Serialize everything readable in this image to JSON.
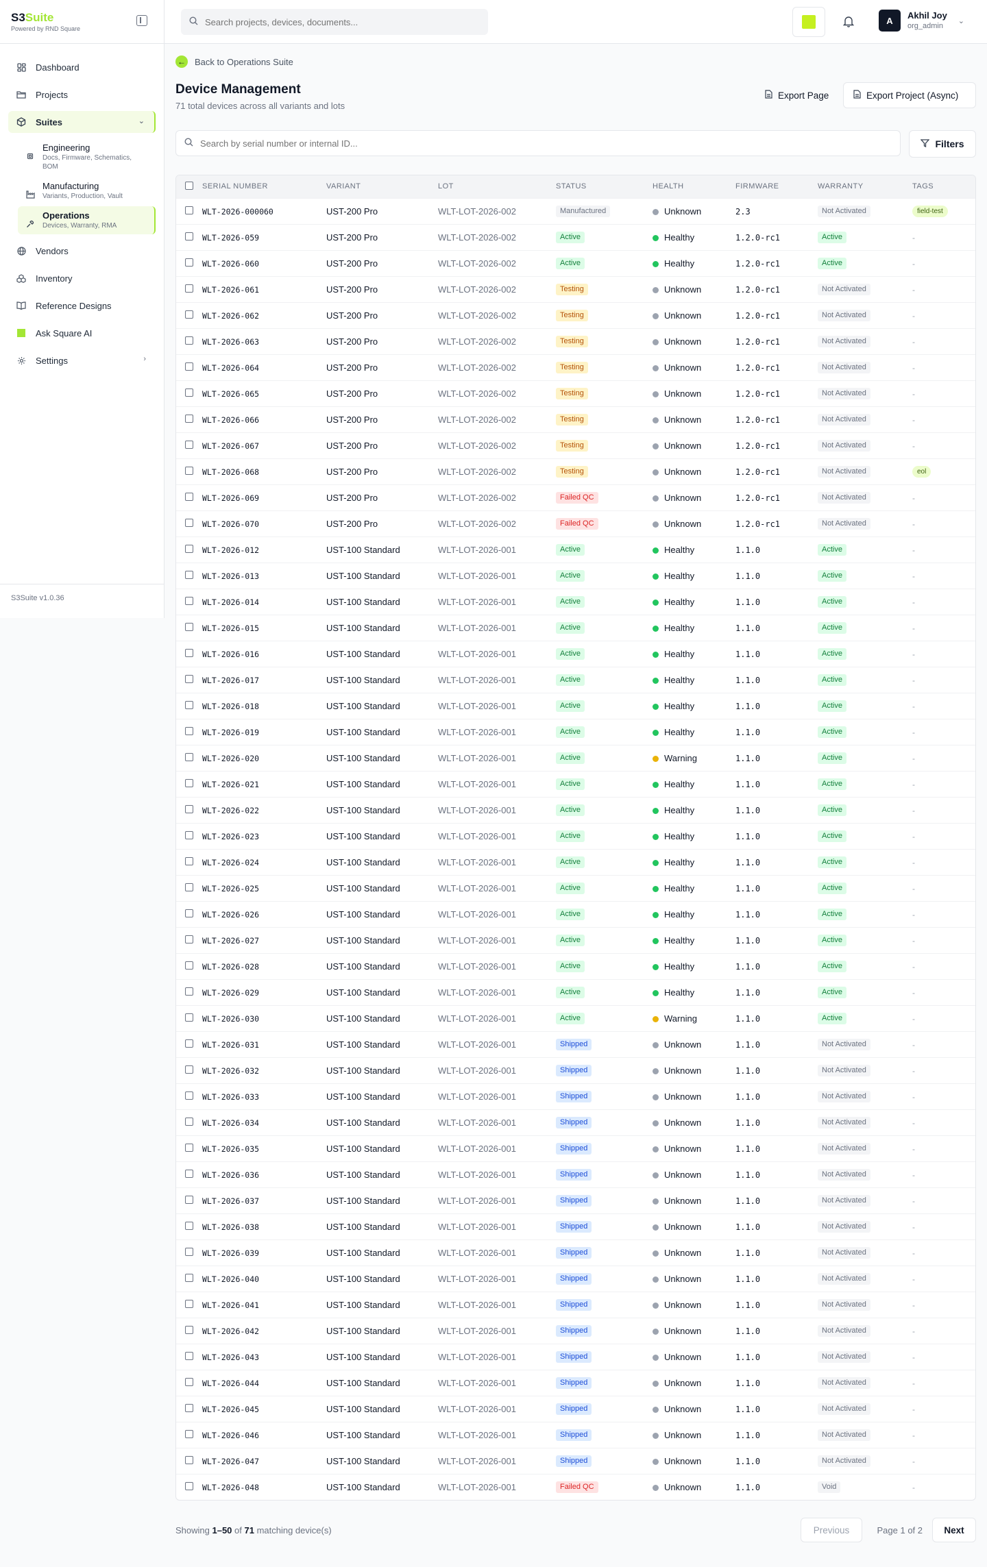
{
  "brand": {
    "name_a": "S3",
    "name_b": "Suite",
    "sub": "Powered by RND Square",
    "accent": "#a3e635"
  },
  "sidebar": {
    "items": [
      {
        "label": "Dashboard",
        "icon": "grid-icon"
      },
      {
        "label": "Projects",
        "icon": "folder-icon"
      },
      {
        "label": "Suites",
        "icon": "box-icon"
      }
    ],
    "sub_items": [
      {
        "title": "Engineering",
        "desc": "Docs, Firmware, Schematics, BOM",
        "icon": "chip-icon"
      },
      {
        "title": "Manufacturing",
        "desc": "Variants, Production, Vault",
        "icon": "factory-icon"
      },
      {
        "title": "Operations",
        "desc": "Devices, Warranty, RMA",
        "icon": "wrench-icon"
      }
    ],
    "items_after": [
      {
        "label": "Vendors",
        "icon": "globe-icon"
      },
      {
        "label": "Inventory",
        "icon": "boxes-icon"
      },
      {
        "label": "Reference Designs",
        "icon": "book-icon"
      },
      {
        "label": "Ask Square AI",
        "icon": "ai-square-icon"
      },
      {
        "label": "Settings",
        "icon": "gear-icon"
      }
    ],
    "version": "S3Suite v1.0.36"
  },
  "topbar": {
    "search_placeholder": "Search projects, devices, documents...",
    "user_initial": "A",
    "user_name": "Akhil Joy",
    "user_role": "org_admin"
  },
  "page": {
    "back_label": "Back to Operations Suite",
    "title": "Device Management",
    "subtitle": "71 total devices across all variants and lots",
    "export_page": "Export Page",
    "export_project": "Export Project (Async)",
    "serial_search_placeholder": "Search by serial number or internal ID...",
    "filters_label": "Filters"
  },
  "table": {
    "columns": [
      "Serial Number",
      "Variant",
      "Lot",
      "Status",
      "Health",
      "Firmware",
      "Warranty",
      "Tags"
    ],
    "rows": [
      {
        "serial": "WLT-2026-000060",
        "variant": "UST-200 Pro",
        "lot": "WLT-LOT-2026-002",
        "status": "Manufactured",
        "health": "Unknown",
        "firmware": "2.3",
        "warranty": "Not Activated",
        "tag": "field-test"
      },
      {
        "serial": "WLT-2026-059",
        "variant": "UST-200 Pro",
        "lot": "WLT-LOT-2026-002",
        "status": "Active",
        "health": "Healthy",
        "firmware": "1.2.0-rc1",
        "warranty": "Active",
        "tag": "-"
      },
      {
        "serial": "WLT-2026-060",
        "variant": "UST-200 Pro",
        "lot": "WLT-LOT-2026-002",
        "status": "Active",
        "health": "Healthy",
        "firmware": "1.2.0-rc1",
        "warranty": "Active",
        "tag": "-"
      },
      {
        "serial": "WLT-2026-061",
        "variant": "UST-200 Pro",
        "lot": "WLT-LOT-2026-002",
        "status": "Testing",
        "health": "Unknown",
        "firmware": "1.2.0-rc1",
        "warranty": "Not Activated",
        "tag": "-"
      },
      {
        "serial": "WLT-2026-062",
        "variant": "UST-200 Pro",
        "lot": "WLT-LOT-2026-002",
        "status": "Testing",
        "health": "Unknown",
        "firmware": "1.2.0-rc1",
        "warranty": "Not Activated",
        "tag": "-"
      },
      {
        "serial": "WLT-2026-063",
        "variant": "UST-200 Pro",
        "lot": "WLT-LOT-2026-002",
        "status": "Testing",
        "health": "Unknown",
        "firmware": "1.2.0-rc1",
        "warranty": "Not Activated",
        "tag": "-"
      },
      {
        "serial": "WLT-2026-064",
        "variant": "UST-200 Pro",
        "lot": "WLT-LOT-2026-002",
        "status": "Testing",
        "health": "Unknown",
        "firmware": "1.2.0-rc1",
        "warranty": "Not Activated",
        "tag": "-"
      },
      {
        "serial": "WLT-2026-065",
        "variant": "UST-200 Pro",
        "lot": "WLT-LOT-2026-002",
        "status": "Testing",
        "health": "Unknown",
        "firmware": "1.2.0-rc1",
        "warranty": "Not Activated",
        "tag": "-"
      },
      {
        "serial": "WLT-2026-066",
        "variant": "UST-200 Pro",
        "lot": "WLT-LOT-2026-002",
        "status": "Testing",
        "health": "Unknown",
        "firmware": "1.2.0-rc1",
        "warranty": "Not Activated",
        "tag": "-"
      },
      {
        "serial": "WLT-2026-067",
        "variant": "UST-200 Pro",
        "lot": "WLT-LOT-2026-002",
        "status": "Testing",
        "health": "Unknown",
        "firmware": "1.2.0-rc1",
        "warranty": "Not Activated",
        "tag": "-"
      },
      {
        "serial": "WLT-2026-068",
        "variant": "UST-200 Pro",
        "lot": "WLT-LOT-2026-002",
        "status": "Testing",
        "health": "Unknown",
        "firmware": "1.2.0-rc1",
        "warranty": "Not Activated",
        "tag": "eol"
      },
      {
        "serial": "WLT-2026-069",
        "variant": "UST-200 Pro",
        "lot": "WLT-LOT-2026-002",
        "status": "Failed QC",
        "health": "Unknown",
        "firmware": "1.2.0-rc1",
        "warranty": "Not Activated",
        "tag": "-"
      },
      {
        "serial": "WLT-2026-070",
        "variant": "UST-200 Pro",
        "lot": "WLT-LOT-2026-002",
        "status": "Failed QC",
        "health": "Unknown",
        "firmware": "1.2.0-rc1",
        "warranty": "Not Activated",
        "tag": "-"
      },
      {
        "serial": "WLT-2026-012",
        "variant": "UST-100 Standard",
        "lot": "WLT-LOT-2026-001",
        "status": "Active",
        "health": "Healthy",
        "firmware": "1.1.0",
        "warranty": "Active",
        "tag": "-"
      },
      {
        "serial": "WLT-2026-013",
        "variant": "UST-100 Standard",
        "lot": "WLT-LOT-2026-001",
        "status": "Active",
        "health": "Healthy",
        "firmware": "1.1.0",
        "warranty": "Active",
        "tag": "-"
      },
      {
        "serial": "WLT-2026-014",
        "variant": "UST-100 Standard",
        "lot": "WLT-LOT-2026-001",
        "status": "Active",
        "health": "Healthy",
        "firmware": "1.1.0",
        "warranty": "Active",
        "tag": "-"
      },
      {
        "serial": "WLT-2026-015",
        "variant": "UST-100 Standard",
        "lot": "WLT-LOT-2026-001",
        "status": "Active",
        "health": "Healthy",
        "firmware": "1.1.0",
        "warranty": "Active",
        "tag": "-"
      },
      {
        "serial": "WLT-2026-016",
        "variant": "UST-100 Standard",
        "lot": "WLT-LOT-2026-001",
        "status": "Active",
        "health": "Healthy",
        "firmware": "1.1.0",
        "warranty": "Active",
        "tag": "-"
      },
      {
        "serial": "WLT-2026-017",
        "variant": "UST-100 Standard",
        "lot": "WLT-LOT-2026-001",
        "status": "Active",
        "health": "Healthy",
        "firmware": "1.1.0",
        "warranty": "Active",
        "tag": "-"
      },
      {
        "serial": "WLT-2026-018",
        "variant": "UST-100 Standard",
        "lot": "WLT-LOT-2026-001",
        "status": "Active",
        "health": "Healthy",
        "firmware": "1.1.0",
        "warranty": "Active",
        "tag": "-"
      },
      {
        "serial": "WLT-2026-019",
        "variant": "UST-100 Standard",
        "lot": "WLT-LOT-2026-001",
        "status": "Active",
        "health": "Healthy",
        "firmware": "1.1.0",
        "warranty": "Active",
        "tag": "-"
      },
      {
        "serial": "WLT-2026-020",
        "variant": "UST-100 Standard",
        "lot": "WLT-LOT-2026-001",
        "status": "Active",
        "health": "Warning",
        "firmware": "1.1.0",
        "warranty": "Active",
        "tag": "-"
      },
      {
        "serial": "WLT-2026-021",
        "variant": "UST-100 Standard",
        "lot": "WLT-LOT-2026-001",
        "status": "Active",
        "health": "Healthy",
        "firmware": "1.1.0",
        "warranty": "Active",
        "tag": "-"
      },
      {
        "serial": "WLT-2026-022",
        "variant": "UST-100 Standard",
        "lot": "WLT-LOT-2026-001",
        "status": "Active",
        "health": "Healthy",
        "firmware": "1.1.0",
        "warranty": "Active",
        "tag": "-"
      },
      {
        "serial": "WLT-2026-023",
        "variant": "UST-100 Standard",
        "lot": "WLT-LOT-2026-001",
        "status": "Active",
        "health": "Healthy",
        "firmware": "1.1.0",
        "warranty": "Active",
        "tag": "-"
      },
      {
        "serial": "WLT-2026-024",
        "variant": "UST-100 Standard",
        "lot": "WLT-LOT-2026-001",
        "status": "Active",
        "health": "Healthy",
        "firmware": "1.1.0",
        "warranty": "Active",
        "tag": "-"
      },
      {
        "serial": "WLT-2026-025",
        "variant": "UST-100 Standard",
        "lot": "WLT-LOT-2026-001",
        "status": "Active",
        "health": "Healthy",
        "firmware": "1.1.0",
        "warranty": "Active",
        "tag": "-"
      },
      {
        "serial": "WLT-2026-026",
        "variant": "UST-100 Standard",
        "lot": "WLT-LOT-2026-001",
        "status": "Active",
        "health": "Healthy",
        "firmware": "1.1.0",
        "warranty": "Active",
        "tag": "-"
      },
      {
        "serial": "WLT-2026-027",
        "variant": "UST-100 Standard",
        "lot": "WLT-LOT-2026-001",
        "status": "Active",
        "health": "Healthy",
        "firmware": "1.1.0",
        "warranty": "Active",
        "tag": "-"
      },
      {
        "serial": "WLT-2026-028",
        "variant": "UST-100 Standard",
        "lot": "WLT-LOT-2026-001",
        "status": "Active",
        "health": "Healthy",
        "firmware": "1.1.0",
        "warranty": "Active",
        "tag": "-"
      },
      {
        "serial": "WLT-2026-029",
        "variant": "UST-100 Standard",
        "lot": "WLT-LOT-2026-001",
        "status": "Active",
        "health": "Healthy",
        "firmware": "1.1.0",
        "warranty": "Active",
        "tag": "-"
      },
      {
        "serial": "WLT-2026-030",
        "variant": "UST-100 Standard",
        "lot": "WLT-LOT-2026-001",
        "status": "Active",
        "health": "Warning",
        "firmware": "1.1.0",
        "warranty": "Active",
        "tag": "-"
      },
      {
        "serial": "WLT-2026-031",
        "variant": "UST-100 Standard",
        "lot": "WLT-LOT-2026-001",
        "status": "Shipped",
        "health": "Unknown",
        "firmware": "1.1.0",
        "warranty": "Not Activated",
        "tag": "-"
      },
      {
        "serial": "WLT-2026-032",
        "variant": "UST-100 Standard",
        "lot": "WLT-LOT-2026-001",
        "status": "Shipped",
        "health": "Unknown",
        "firmware": "1.1.0",
        "warranty": "Not Activated",
        "tag": "-"
      },
      {
        "serial": "WLT-2026-033",
        "variant": "UST-100 Standard",
        "lot": "WLT-LOT-2026-001",
        "status": "Shipped",
        "health": "Unknown",
        "firmware": "1.1.0",
        "warranty": "Not Activated",
        "tag": "-"
      },
      {
        "serial": "WLT-2026-034",
        "variant": "UST-100 Standard",
        "lot": "WLT-LOT-2026-001",
        "status": "Shipped",
        "health": "Unknown",
        "firmware": "1.1.0",
        "warranty": "Not Activated",
        "tag": "-"
      },
      {
        "serial": "WLT-2026-035",
        "variant": "UST-100 Standard",
        "lot": "WLT-LOT-2026-001",
        "status": "Shipped",
        "health": "Unknown",
        "firmware": "1.1.0",
        "warranty": "Not Activated",
        "tag": "-"
      },
      {
        "serial": "WLT-2026-036",
        "variant": "UST-100 Standard",
        "lot": "WLT-LOT-2026-001",
        "status": "Shipped",
        "health": "Unknown",
        "firmware": "1.1.0",
        "warranty": "Not Activated",
        "tag": "-"
      },
      {
        "serial": "WLT-2026-037",
        "variant": "UST-100 Standard",
        "lot": "WLT-LOT-2026-001",
        "status": "Shipped",
        "health": "Unknown",
        "firmware": "1.1.0",
        "warranty": "Not Activated",
        "tag": "-"
      },
      {
        "serial": "WLT-2026-038",
        "variant": "UST-100 Standard",
        "lot": "WLT-LOT-2026-001",
        "status": "Shipped",
        "health": "Unknown",
        "firmware": "1.1.0",
        "warranty": "Not Activated",
        "tag": "-"
      },
      {
        "serial": "WLT-2026-039",
        "variant": "UST-100 Standard",
        "lot": "WLT-LOT-2026-001",
        "status": "Shipped",
        "health": "Unknown",
        "firmware": "1.1.0",
        "warranty": "Not Activated",
        "tag": "-"
      },
      {
        "serial": "WLT-2026-040",
        "variant": "UST-100 Standard",
        "lot": "WLT-LOT-2026-001",
        "status": "Shipped",
        "health": "Unknown",
        "firmware": "1.1.0",
        "warranty": "Not Activated",
        "tag": "-"
      },
      {
        "serial": "WLT-2026-041",
        "variant": "UST-100 Standard",
        "lot": "WLT-LOT-2026-001",
        "status": "Shipped",
        "health": "Unknown",
        "firmware": "1.1.0",
        "warranty": "Not Activated",
        "tag": "-"
      },
      {
        "serial": "WLT-2026-042",
        "variant": "UST-100 Standard",
        "lot": "WLT-LOT-2026-001",
        "status": "Shipped",
        "health": "Unknown",
        "firmware": "1.1.0",
        "warranty": "Not Activated",
        "tag": "-"
      },
      {
        "serial": "WLT-2026-043",
        "variant": "UST-100 Standard",
        "lot": "WLT-LOT-2026-001",
        "status": "Shipped",
        "health": "Unknown",
        "firmware": "1.1.0",
        "warranty": "Not Activated",
        "tag": "-"
      },
      {
        "serial": "WLT-2026-044",
        "variant": "UST-100 Standard",
        "lot": "WLT-LOT-2026-001",
        "status": "Shipped",
        "health": "Unknown",
        "firmware": "1.1.0",
        "warranty": "Not Activated",
        "tag": "-"
      },
      {
        "serial": "WLT-2026-045",
        "variant": "UST-100 Standard",
        "lot": "WLT-LOT-2026-001",
        "status": "Shipped",
        "health": "Unknown",
        "firmware": "1.1.0",
        "warranty": "Not Activated",
        "tag": "-"
      },
      {
        "serial": "WLT-2026-046",
        "variant": "UST-100 Standard",
        "lot": "WLT-LOT-2026-001",
        "status": "Shipped",
        "health": "Unknown",
        "firmware": "1.1.0",
        "warranty": "Not Activated",
        "tag": "-"
      },
      {
        "serial": "WLT-2026-047",
        "variant": "UST-100 Standard",
        "lot": "WLT-LOT-2026-001",
        "status": "Shipped",
        "health": "Unknown",
        "firmware": "1.1.0",
        "warranty": "Not Activated",
        "tag": "-"
      },
      {
        "serial": "WLT-2026-048",
        "variant": "UST-100 Standard",
        "lot": "WLT-LOT-2026-001",
        "status": "Failed QC",
        "health": "Unknown",
        "firmware": "1.1.0",
        "warranty": "Void",
        "tag": "-"
      }
    ]
  },
  "pagination": {
    "showing_prefix": "Showing ",
    "range": "1–50",
    "of_text": " of ",
    "total": "71",
    "suffix": " matching device(s)",
    "prev_label": "Previous",
    "page_label": "Page 1 of 2",
    "next_label": "Next"
  }
}
